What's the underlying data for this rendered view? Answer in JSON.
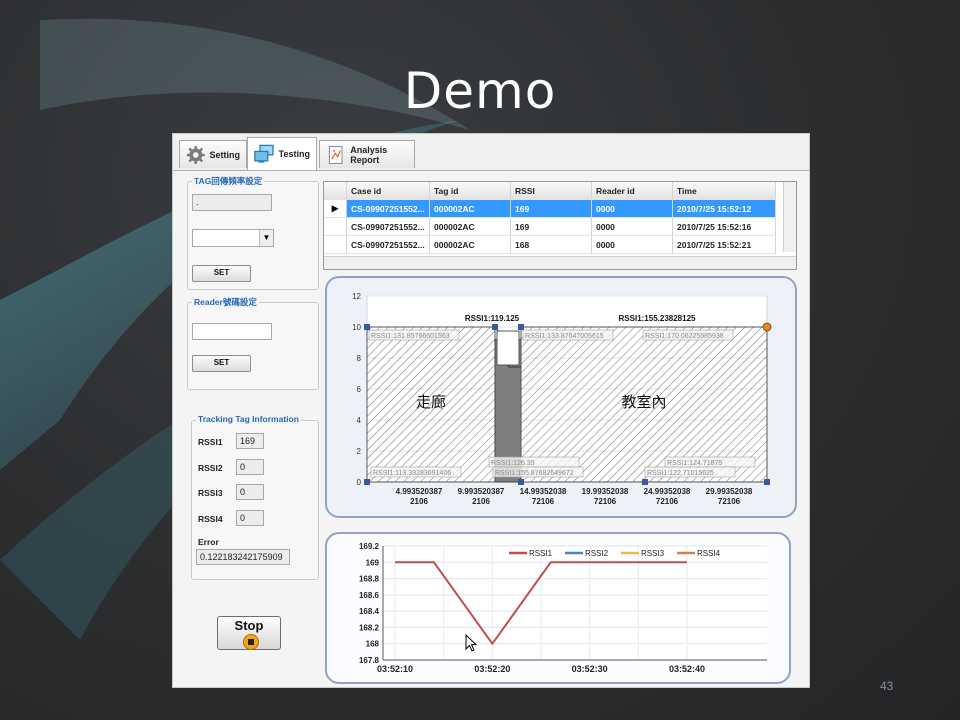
{
  "slide": {
    "title": "Demo",
    "page_number": "43"
  },
  "tabs": [
    {
      "label": "Setting",
      "icon": "gear-icon"
    },
    {
      "label": "Testing",
      "icon": "monitors-icon"
    },
    {
      "label": "Analysis Report",
      "icon": "report-icon"
    }
  ],
  "left_panel": {
    "tag_freq": {
      "title": "TAG回傳頻率設定",
      "value": ".",
      "set_label": "SET"
    },
    "reader": {
      "title": "Reader號碼設定",
      "value": "",
      "set_label": "SET"
    },
    "tracking": {
      "title": "Tracking Tag Information",
      "rssi": [
        {
          "label": "RSSI1",
          "value": "169"
        },
        {
          "label": "RSSI2",
          "value": "0"
        },
        {
          "label": "RSSI3",
          "value": "0"
        },
        {
          "label": "RSSI4",
          "value": "0"
        }
      ],
      "error_label": "Error",
      "error_value": "0.122183242175909"
    },
    "stop_label": "Stop"
  },
  "grid": {
    "columns": [
      "Case id",
      "Tag id",
      "RSSI",
      "Reader id",
      "Time"
    ],
    "rows": [
      [
        "CS-09907251552...",
        "000002AC",
        "169",
        "0000",
        "2010/7/25 15:52:12"
      ],
      [
        "CS-09907251552...",
        "000002AC",
        "169",
        "0000",
        "2010/7/25 15:52:16"
      ],
      [
        "CS-09907251552...",
        "000002AC",
        "168",
        "0000",
        "2010/7/25 15:52:21"
      ]
    ]
  },
  "position_chart": {
    "y_ticks": [
      "0",
      "2",
      "4",
      "6",
      "8",
      "10",
      "12"
    ],
    "x_ticks": [
      "4.993520387\n2106",
      "9.993520387\n2106",
      "14.99352038\n72106",
      "19.99352038\n72106",
      "24.99352038\n72106",
      "29.99352038\n72106"
    ],
    "region_left_label": "走廊",
    "region_right_label": "教室內",
    "top_labels": [
      "RSSI1:119.125",
      "RSSI1:155.23828125"
    ],
    "corner_labels": [
      "RSSI1:131.85766601563",
      "RSSI1:133.87047005615",
      "RSSI1:170.06225585938",
      "RSSI1:113.33283691406",
      "RSSI1:126.35",
      "RSSI1:155.87682649672",
      "RSSI1:124.71875",
      "RSSI1:122.71015625"
    ],
    "colors": {
      "hatch": "#4a4a4a",
      "fill": "#7f7f7f",
      "frame": "#2b4a8a"
    }
  },
  "chart_data": {
    "type": "line",
    "x": [
      "03:52:10",
      "03:52:15",
      "03:52:20",
      "03:52:25",
      "03:52:30",
      "03:52:35",
      "03:52:40"
    ],
    "x_ticks": [
      "03:52:10",
      "03:52:20",
      "03:52:30",
      "03:52:40"
    ],
    "y_ticks": [
      "167.8",
      "168",
      "168.2",
      "168.4",
      "168.6",
      "168.8",
      "169",
      "169.2"
    ],
    "ylim": [
      167.8,
      169.2
    ],
    "series": [
      {
        "name": "RSSI1",
        "color": "#c0504d",
        "points": [
          [
            "03:52:10",
            169
          ],
          [
            "03:52:14",
            169
          ],
          [
            "03:52:20",
            168
          ],
          [
            "03:52:26",
            169
          ],
          [
            "03:52:40",
            169
          ]
        ]
      },
      {
        "name": "RSSI2",
        "color": "#4f81bd",
        "points": []
      },
      {
        "name": "RSSI3",
        "color": "#f0b84a",
        "points": []
      },
      {
        "name": "RSSI4",
        "color": "#d08050",
        "points": []
      }
    ],
    "legend_position": "top-right"
  }
}
